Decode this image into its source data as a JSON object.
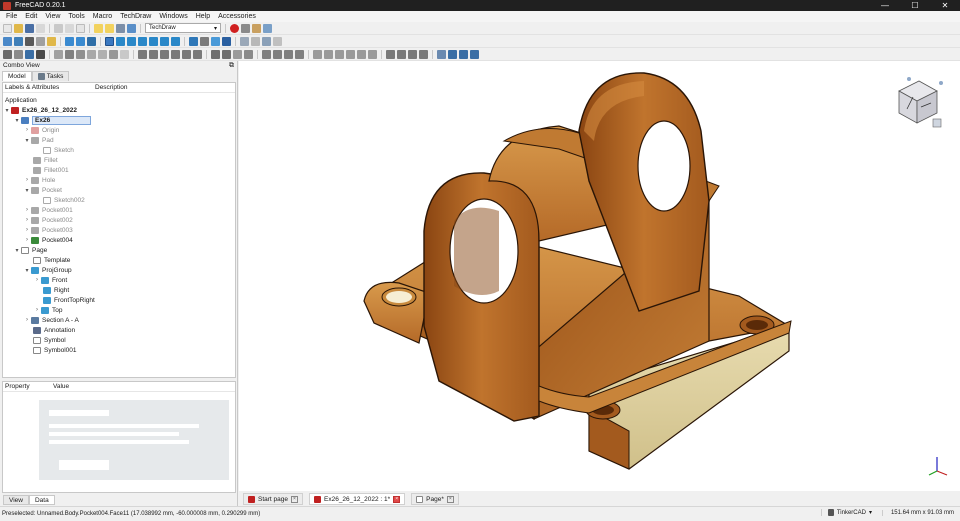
{
  "app": {
    "title": "FreeCAD 0.20.1"
  },
  "window_controls": {
    "minimize": "—",
    "maximize": "☐",
    "close": "✕"
  },
  "menu": [
    "File",
    "Edit",
    "View",
    "Tools",
    "Macro",
    "TechDraw",
    "Windows",
    "Help",
    "Accessories"
  ],
  "toolbar": {
    "workbench": "TechDraw"
  },
  "combo_view": {
    "title": "Combo View",
    "tabs": [
      "Model",
      "Tasks"
    ],
    "columns": [
      "Labels & Attributes",
      "Description"
    ]
  },
  "tree": [
    {
      "label": "Application"
    },
    {
      "label": "Ex26_26_12_2022"
    },
    {
      "label": "Ex26"
    },
    {
      "label": "Origin"
    },
    {
      "label": "Pad"
    },
    {
      "label": "Sketch"
    },
    {
      "label": "Fillet"
    },
    {
      "label": "Fillet001"
    },
    {
      "label": "Hole"
    },
    {
      "label": "Pocket"
    },
    {
      "label": "Sketch002"
    },
    {
      "label": "Pocket001"
    },
    {
      "label": "Pocket002"
    },
    {
      "label": "Pocket003"
    },
    {
      "label": "Pocket004"
    },
    {
      "label": "Page"
    },
    {
      "label": "Template"
    },
    {
      "label": "ProjGroup"
    },
    {
      "label": "Front"
    },
    {
      "label": "Right"
    },
    {
      "label": "FrontTopRight"
    },
    {
      "label": "Top"
    },
    {
      "label": "Section A - A"
    },
    {
      "label": "Annotation"
    },
    {
      "label": "Symbol"
    },
    {
      "label": "Symbol001"
    }
  ],
  "property_view": {
    "columns": [
      "Property",
      "Value"
    ],
    "tabs": [
      "View",
      "Data"
    ]
  },
  "doc_tabs": [
    "Start page",
    "Ex26_26_12_2022 : 1*",
    "Page*"
  ],
  "status": {
    "text": "Preselected: Unnamed.Body.Pocket004.Face11 (17.038992 mm, -60.000008 mm, 0.290299 mm)",
    "nav_style": "TinkerCAD",
    "dimensions": "151.64 mm x 91.03 mm"
  },
  "colors": {
    "titlebar": "#202020",
    "wood": "#b8692a",
    "wood_dark": "#7a3d12",
    "wood_light": "#d6913e",
    "selection": "#dce8f8"
  }
}
